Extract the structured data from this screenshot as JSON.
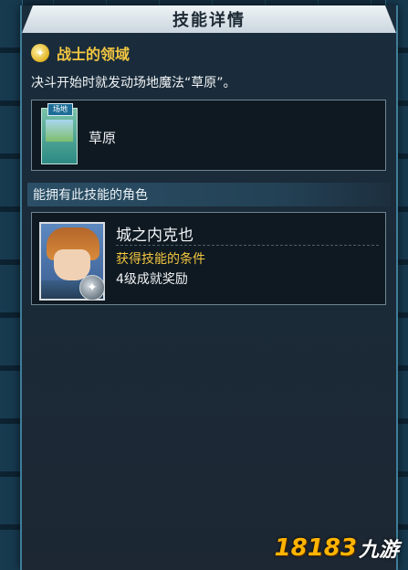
{
  "header": {
    "title": "技能详情"
  },
  "skill": {
    "name": "战士的领域",
    "description": "决斗开始时就发动场地魔法“草原”。",
    "card": {
      "tag": "场地",
      "name": "草原"
    }
  },
  "characters_section": {
    "title": "能拥有此技能的角色",
    "entries": [
      {
        "name": "城之内克也",
        "condition_label": "获得技能的条件",
        "condition": "4级成就奖励"
      }
    ]
  },
  "watermark": {
    "number": "18183",
    "text": "九游"
  },
  "colors": {
    "accent_gold": "#f2c640",
    "panel_border": "#3f7d98"
  }
}
